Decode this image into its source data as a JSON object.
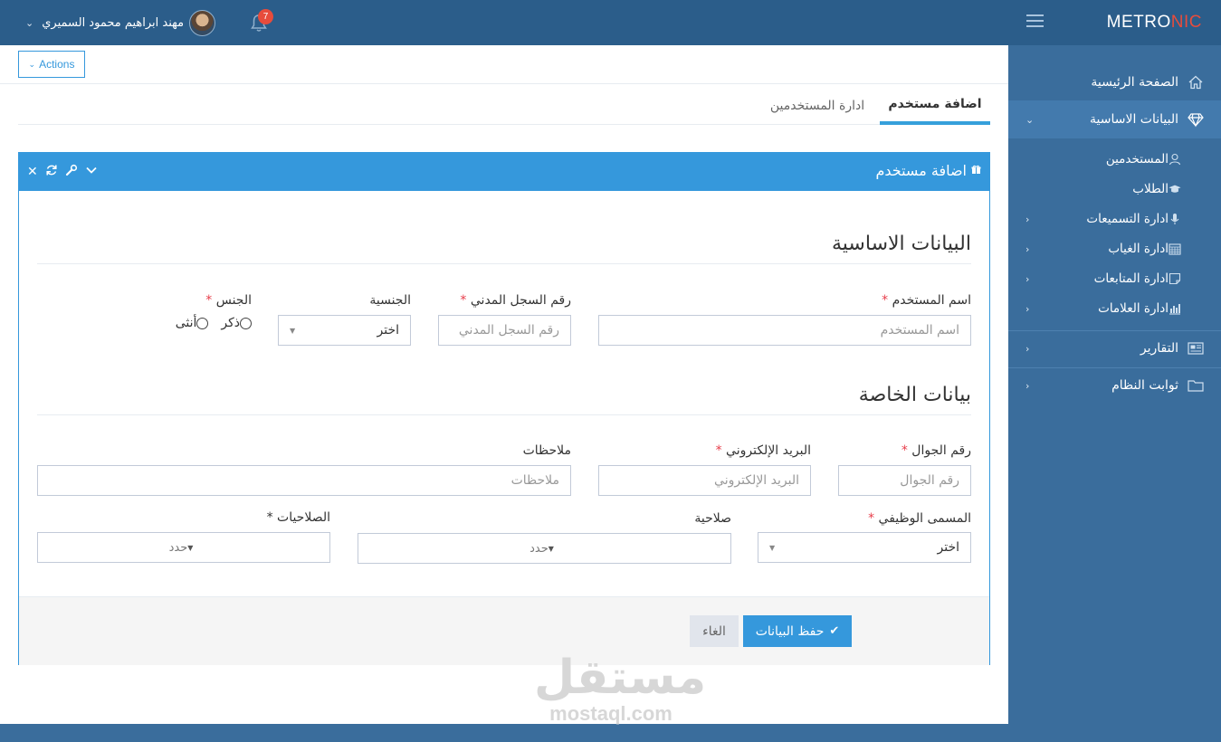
{
  "header": {
    "brand_main": "METRO",
    "brand_accent": "NIC",
    "user_name": "مهند ابراهيم محمود السميري",
    "notification_count": "7"
  },
  "sidebar": {
    "items": [
      {
        "label": "الصفحة الرئيسية",
        "icon": "home-icon"
      },
      {
        "label": "البيانات الاساسية",
        "icon": "diamond-icon"
      },
      {
        "label": "التقارير",
        "icon": "newspaper-icon"
      },
      {
        "label": "ثوابت النظام",
        "icon": "folder-icon"
      }
    ],
    "sub_items": [
      {
        "label": "المستخدمين",
        "icon": "user-icon"
      },
      {
        "label": "الطلاب",
        "icon": "graduation-cap-icon"
      },
      {
        "label": "ادارة التسميعات",
        "icon": "microphone-icon"
      },
      {
        "label": "ادارة الغياب",
        "icon": "calendar-icon"
      },
      {
        "label": "ادارة المتابعات",
        "icon": "note-icon"
      },
      {
        "label": "ادارة العلامات",
        "icon": "bar-chart-icon"
      }
    ]
  },
  "toolbar": {
    "actions_label": "Actions"
  },
  "tabs": [
    {
      "label": "اضافة مستخدم"
    },
    {
      "label": "ادارة المستخدمين"
    }
  ],
  "portlet": {
    "title": "اضافة مستخدم"
  },
  "form": {
    "section_basic": "البيانات الاساسية",
    "section_private": "بيانات الخاصة",
    "username": {
      "label": "اسم المستخدم",
      "placeholder": "اسم المستخدم"
    },
    "civil_id": {
      "label": "رقم السجل المدني",
      "placeholder": "رقم السجل المدني"
    },
    "nationality": {
      "label": "الجنسية",
      "value": "اختر"
    },
    "gender": {
      "label": "الجنس",
      "options": [
        "ذكر",
        "أنثى"
      ]
    },
    "mobile": {
      "label": "رقم الجوال",
      "placeholder": "رقم الجوال"
    },
    "email": {
      "label": "البريد الإلكتروني",
      "placeholder": "البريد الإلكتروني"
    },
    "notes": {
      "label": "ملاحظات",
      "placeholder": "ملاحظات"
    },
    "job_title": {
      "label": "المسمى الوظيفي",
      "value": "اختر"
    },
    "permission": {
      "label": "صلاحية",
      "value": "حدد"
    },
    "permissions": {
      "label": "الصلاحيات",
      "value": "حدد"
    },
    "required_mark": "*"
  },
  "buttons": {
    "save": "حفظ البيانات",
    "cancel": "الغاء"
  },
  "watermark": {
    "arabic": "مستقل",
    "latin": "mostaql.com"
  },
  "colors": {
    "primary": "#3598dc",
    "header": "#2b5d8a",
    "sidebar": "#3a6d9c",
    "danger": "#e73d4a"
  }
}
